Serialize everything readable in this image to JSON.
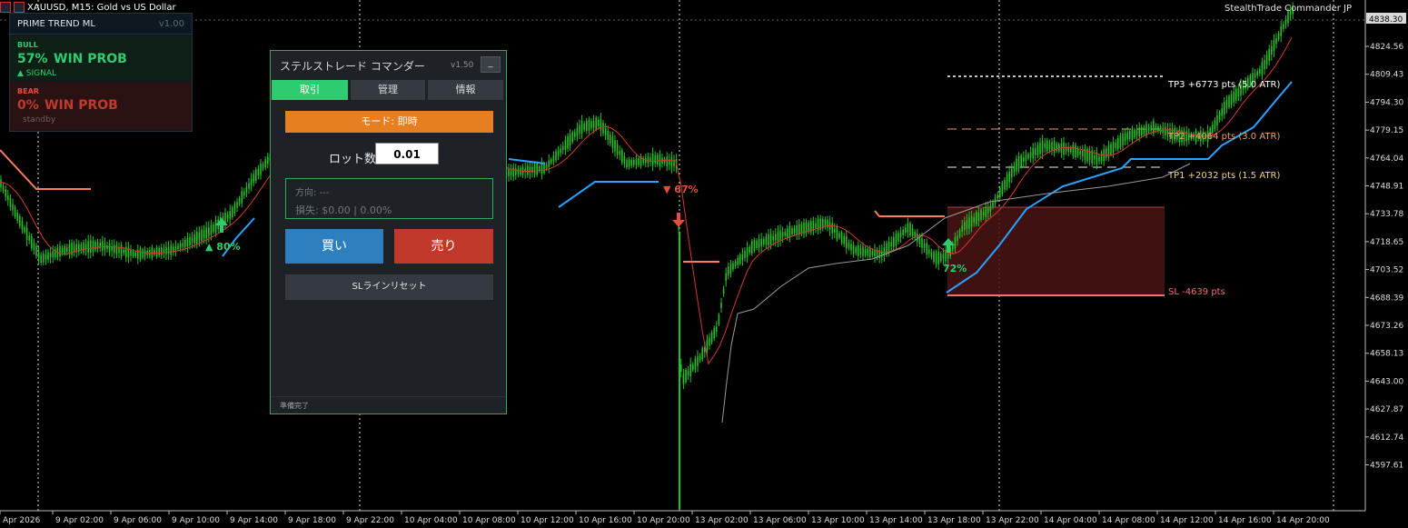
{
  "chart_header": {
    "symbol": "XAUUSD, M15:  Gold vs US Dollar",
    "brand": "StealthTrade Commander JP"
  },
  "prime_trend": {
    "title": "PRIME TREND  ML",
    "version": "v1.00",
    "bull": {
      "label": "BULL",
      "percent": "57%",
      "text": "WIN PROB",
      "signal": "▲ SIGNAL"
    },
    "bear": {
      "label": "BEAR",
      "percent": "0%",
      "text": "WIN PROB",
      "status": "standby"
    }
  },
  "commander": {
    "title": "ステルストレード コマンダー",
    "version": "v1.50",
    "minimize": "_",
    "tabs": [
      {
        "label": "取引"
      },
      {
        "label": "管理"
      },
      {
        "label": "情報"
      }
    ],
    "mode": "モード: 即時",
    "lot_label": "ロット数",
    "lot_value": "0.01",
    "direction": "方向: ---",
    "pnl": "損失: $0.00 | 0.00%",
    "buy": "買い",
    "sell": "売り",
    "sl_reset": "SLラインリセット",
    "status": "準備完了"
  },
  "chart_annotations": {
    "tp3": "TP3  +6773 pts  (5.0 ATR)",
    "tp2": "TP2  +4064 pts  (3.0 ATR)",
    "tp1": "TP1  +2032 pts  (1.5 ATR)",
    "sl": "SL  -4639 pts",
    "sig_80": "▲ 80%",
    "sig_67": "▼ 67%",
    "sig_72": "72%"
  },
  "price_axis": {
    "current_price": "4838.30",
    "ticks": [
      "4824.56",
      "4809.43",
      "4794.30",
      "4779.15",
      "4764.04",
      "4748.91",
      "4733.78",
      "4718.65",
      "4703.52",
      "4688.39",
      "4673.26",
      "4658.13",
      "4643.00",
      "4627.87",
      "4612.74",
      "4597.61"
    ]
  },
  "time_axis": {
    "ticks": [
      "Apr 2026",
      "9 Apr 02:00",
      "9 Apr 06:00",
      "9 Apr 10:00",
      "9 Apr 14:00",
      "9 Apr 18:00",
      "9 Apr 22:00",
      "10 Apr 04:00",
      "10 Apr 08:00",
      "10 Apr 12:00",
      "10 Apr 16:00",
      "10 Apr 20:00",
      "13 Apr 02:00",
      "13 Apr 06:00",
      "13 Apr 10:00",
      "13 Apr 14:00",
      "13 Apr 18:00",
      "13 Apr 22:00",
      "14 Apr 04:00",
      "14 Apr 08:00",
      "14 Apr 12:00",
      "14 Apr 16:00",
      "14 Apr 20:00"
    ]
  },
  "colors": {
    "bull": "#2ecc71",
    "bear": "#e74c3c",
    "candle": "#22c322",
    "ema": "#d23a2e",
    "trail": "#29a3ff",
    "sell_btn": "#c0392b",
    "buy_btn": "#2e7fbf",
    "mode": "#e67e22"
  }
}
